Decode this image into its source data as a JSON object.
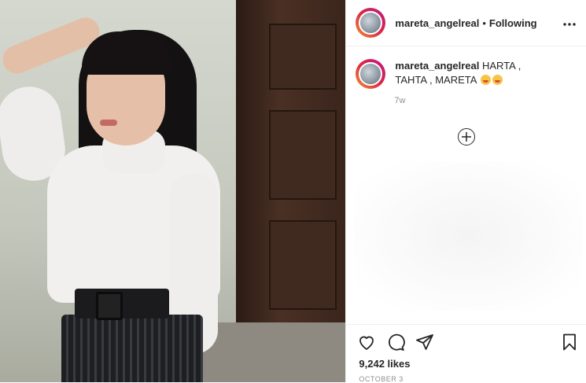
{
  "post": {
    "header": {
      "username": "mareta_angelreal",
      "separator": "•",
      "follow_status": "Following",
      "more_icon": "ellipsis-icon"
    },
    "caption": {
      "username": "mareta_angelreal",
      "text": "HARTA , TAHTA , MARETA",
      "emojis": [
        "grinning-face-with-tongue-emoji",
        "grinning-face-with-tongue-emoji"
      ],
      "age": "7w"
    },
    "load_more_icon": "plus-circle-icon",
    "actions": {
      "like_icon": "heart-icon",
      "comment_icon": "comment-icon",
      "share_icon": "paper-plane-icon",
      "save_icon": "bookmark-icon"
    },
    "likes": "9,242 likes",
    "date": "OCTOBER 3"
  },
  "colors": {
    "text": "#262626",
    "secondary": "#8e8e8e",
    "border": "#efefef"
  }
}
